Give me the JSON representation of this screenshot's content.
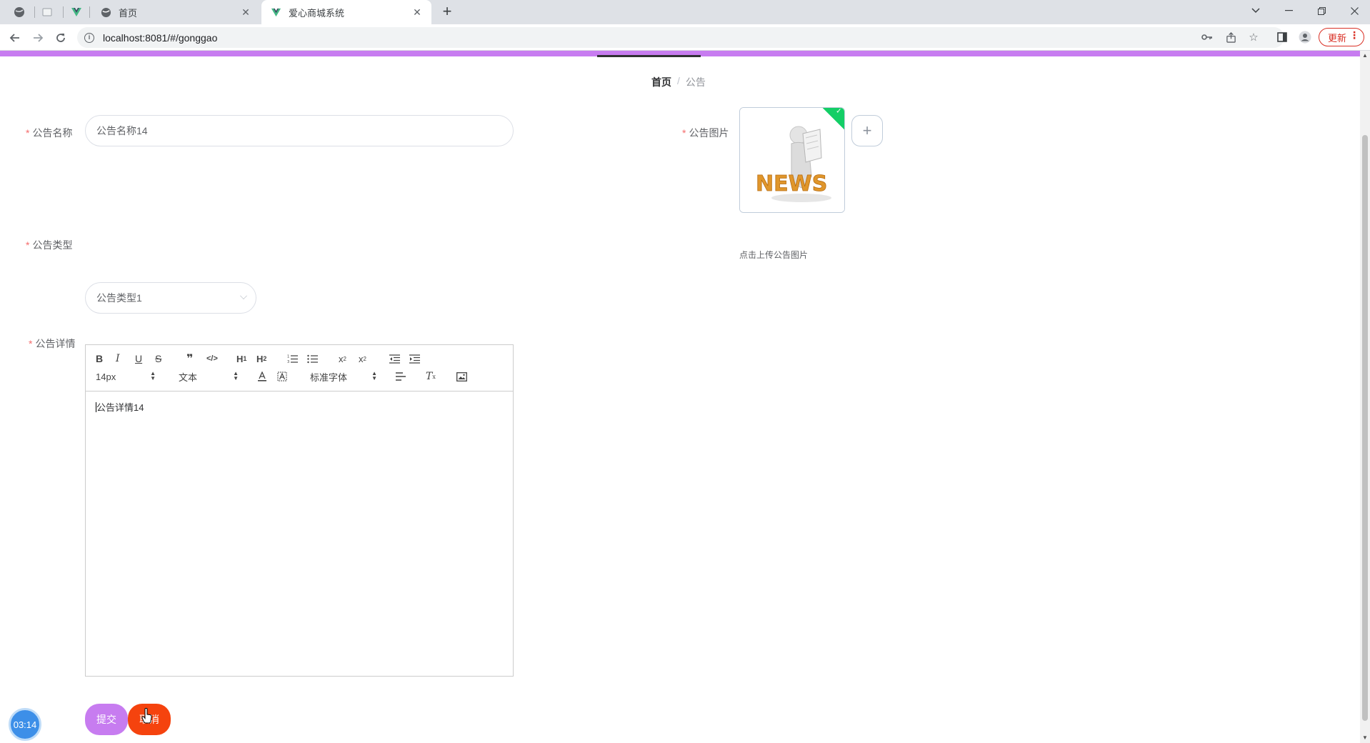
{
  "browser": {
    "tabs": [
      {
        "title": "首页",
        "active": false
      },
      {
        "title": "爱心商城系统",
        "active": true
      }
    ],
    "url": "localhost:8081/#/gonggao",
    "update_label": "更新"
  },
  "breadcrumb": {
    "home": "首页",
    "separator": "/",
    "current": "公告"
  },
  "form": {
    "name_label": "公告名称",
    "name_value": "公告名称14",
    "image_label": "公告图片",
    "image_alt": "NEWS",
    "upload_tip": "点击上传公告图片",
    "type_label": "公告类型",
    "type_value": "公告类型1",
    "detail_label": "公告详情",
    "required_mark": "*"
  },
  "editor": {
    "font_size": "14px",
    "format": "文本",
    "font_family": "标准字体",
    "content": "公告详情14"
  },
  "buttons": {
    "submit": "提交",
    "cancel": "取消"
  },
  "clock": "03:14",
  "colors": {
    "accent": "#c77cf0",
    "cancel": "#f5430e",
    "success": "#13ce66"
  }
}
